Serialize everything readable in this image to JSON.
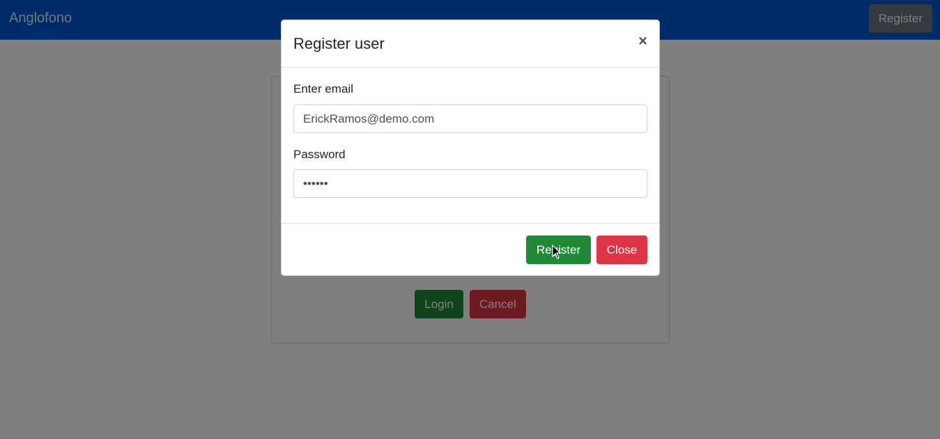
{
  "navbar": {
    "brand": "Anglofono",
    "register_label": "Register",
    "color": "#0056d2"
  },
  "login_card": {
    "login_label": "Login",
    "cancel_label": "Cancel"
  },
  "modal": {
    "title": "Register user",
    "close_icon": "×",
    "email_label": "Enter email",
    "email_value": "ErickRamos@demo.com",
    "password_label": "Password",
    "password_value": "••••••",
    "register_label": "Register",
    "close_label": "Close"
  },
  "colors": {
    "success": "#218838",
    "danger": "#dc3545",
    "secondary": "#6c757d"
  }
}
